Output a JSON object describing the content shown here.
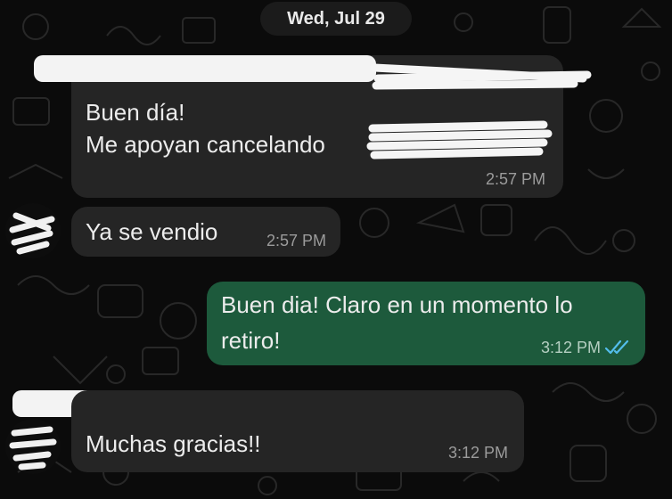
{
  "chat": {
    "date_separator": "Wed, Jul 29",
    "messages": [
      {
        "direction": "incoming",
        "line1": "Buen día!",
        "line2": "Me apoyan cancelando",
        "time": "2:57 PM"
      },
      {
        "direction": "incoming",
        "text": "Ya se vendio",
        "time": "2:57 PM"
      },
      {
        "direction": "outgoing",
        "line1": "Buen dia! Claro en un momento lo",
        "line2": "retiro!",
        "time": "3:12 PM",
        "status": "read"
      },
      {
        "direction": "incoming",
        "text": "Muchas gracias!!",
        "time": "3:12 PM"
      }
    ]
  },
  "colors": {
    "background": "#0b0b0b",
    "incoming_bubble": "#252525",
    "outgoing_bubble": "#1d5a3c",
    "read_tick": "#53bdeb"
  },
  "icons": {
    "read_receipt": "double-check-icon"
  }
}
